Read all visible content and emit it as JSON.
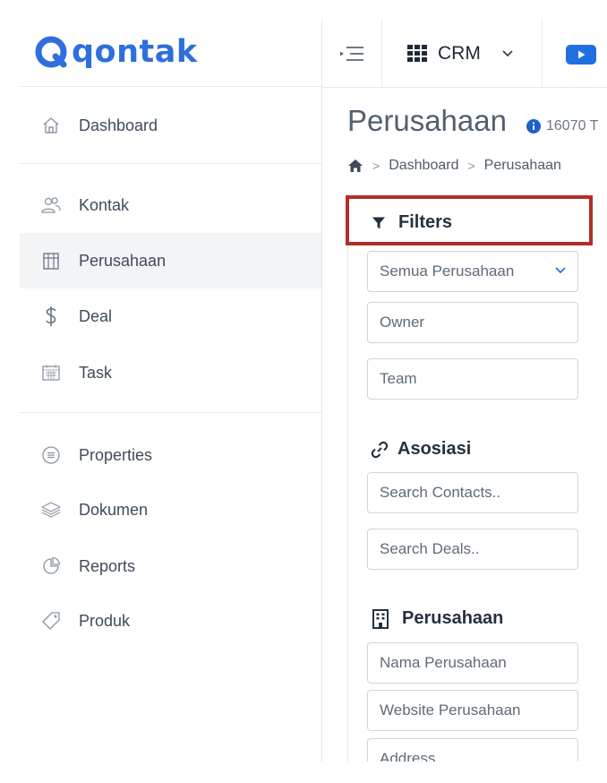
{
  "app": {
    "logo_text": "qontak",
    "brand_color": "#2f6fdc"
  },
  "sidebar": {
    "items": [
      {
        "label": "Dashboard",
        "icon": "home-icon"
      },
      {
        "label": "Kontak",
        "icon": "users-icon"
      },
      {
        "label": "Perusahaan",
        "icon": "building-icon",
        "active": true
      },
      {
        "label": "Deal",
        "icon": "dollar-icon"
      },
      {
        "label": "Task",
        "icon": "calendar-icon"
      },
      {
        "label": "Properties",
        "icon": "list-circle-icon"
      },
      {
        "label": "Dokumen",
        "icon": "layers-icon"
      },
      {
        "label": "Reports",
        "icon": "pie-chart-icon"
      },
      {
        "label": "Produk",
        "icon": "tag-icon"
      }
    ]
  },
  "topbar": {
    "menu_toggle_icon": "collapse-menu-icon",
    "module_label": "CRM",
    "module_icon": "grid-icon",
    "video_icon": "youtube-icon"
  },
  "page": {
    "title": "Perusahaan",
    "count_text": "16070 T",
    "breadcrumb": {
      "home_icon": "home-solid-icon",
      "items": [
        "Dashboard",
        "Perusahaan"
      ]
    }
  },
  "filters": {
    "title": "Filters",
    "highlight_color": "#b03028",
    "select_value": "Semua Perusahaan",
    "owner_placeholder": "Owner",
    "team_placeholder": "Team"
  },
  "asosiasi": {
    "title": "Asosiasi",
    "contacts_placeholder": "Search Contacts..",
    "deals_placeholder": "Search Deals.."
  },
  "perusahaan_section": {
    "title": "Perusahaan",
    "name_placeholder": "Nama Perusahaan",
    "website_placeholder": "Website Perusahaan",
    "address_placeholder": "Address"
  }
}
